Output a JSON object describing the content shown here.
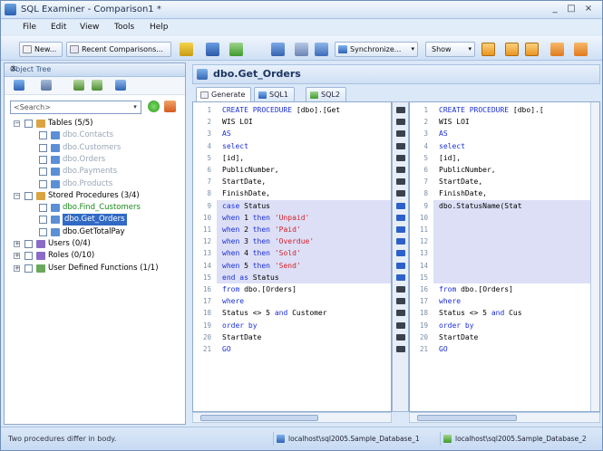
{
  "window": {
    "title": "SQL Examiner - Comparison1 *",
    "controls": [
      "_",
      "□",
      "×"
    ]
  },
  "menu": [
    "File",
    "Edit",
    "View",
    "Tools",
    "Help"
  ],
  "toolbar": {
    "new_label": "New...",
    "recent_label": "Recent Comparisons...",
    "synchronize_label": "Synchronize...",
    "show_label": "Show"
  },
  "object_tree": {
    "header": "Object Tree",
    "search": {
      "value": "<Search>"
    },
    "items": [
      {
        "label": "Tables (5/5)",
        "style": "normal"
      },
      {
        "label": "dbo.Contacts",
        "style": "gray"
      },
      {
        "label": "dbo.Customers",
        "style": "gray"
      },
      {
        "label": "dbo.Orders",
        "style": "gray"
      },
      {
        "label": "dbo.Payments",
        "style": "gray"
      },
      {
        "label": "dbo.Products",
        "style": "gray"
      },
      {
        "label": "Stored Procedures (3/4)",
        "style": "normal"
      },
      {
        "label": "dbo.Find_Customers",
        "style": "green"
      },
      {
        "label": "dbo.Get_Orders",
        "style": "selected"
      },
      {
        "label": "dbo.GetTotalPay",
        "style": "normal"
      },
      {
        "label": "Users (0/4)",
        "style": "normal"
      },
      {
        "label": "Roles (0/10)",
        "style": "normal"
      },
      {
        "label": "User Defined Functions (1/1)",
        "style": "normal"
      }
    ]
  },
  "document": {
    "title": "dbo.Get_Orders",
    "tabs": [
      "Generate",
      "SQL1",
      "SQL2"
    ]
  },
  "left_code": [
    "CREATE  PROCEDURE [dbo].[Get",
    "    WIS LOI",
    "AS",
    "select",
    "    [id],",
    "    PublicNumber,",
    "    StartDate,",
    "    FinishDate,",
    "    case Status",
    "            when 1 then 'Unpaid'",
    "            when 2 then 'Paid'",
    "            when 3 then 'Overdue'",
    "            when 4 then 'Sold'",
    "            when 5 then 'Send'",
    "    end as Status",
    "from dbo.[Orders]",
    "where",
    "    Status <> 5 and Customer",
    "order by",
    "    StartDate",
    "GO"
  ],
  "right_code": [
    "CREATE  PROCEDURE [dbo].[",
    "    WIS LOI",
    "AS",
    "select",
    "    [id],",
    "    PublicNumber,",
    "    StartDate,",
    "    FinishDate,",
    "    dbo.StatusName(Stat",
    "",
    "",
    "",
    "",
    "",
    "",
    "from dbo.[Orders]",
    "where",
    "    Status <> 5 and Cus",
    "order by",
    "    StartDate",
    "GO"
  ],
  "status": {
    "message": "Two procedures differ in body.",
    "db1": "localhost\\sql2005.Sample_Database_1",
    "db2": "localhost\\sql2005.Sample_Database_2"
  },
  "colors": {
    "accent": "#316ac5",
    "keyword": "#1b2fd6",
    "string": "#d3202a",
    "diff_highlight": "#dcdff6"
  }
}
